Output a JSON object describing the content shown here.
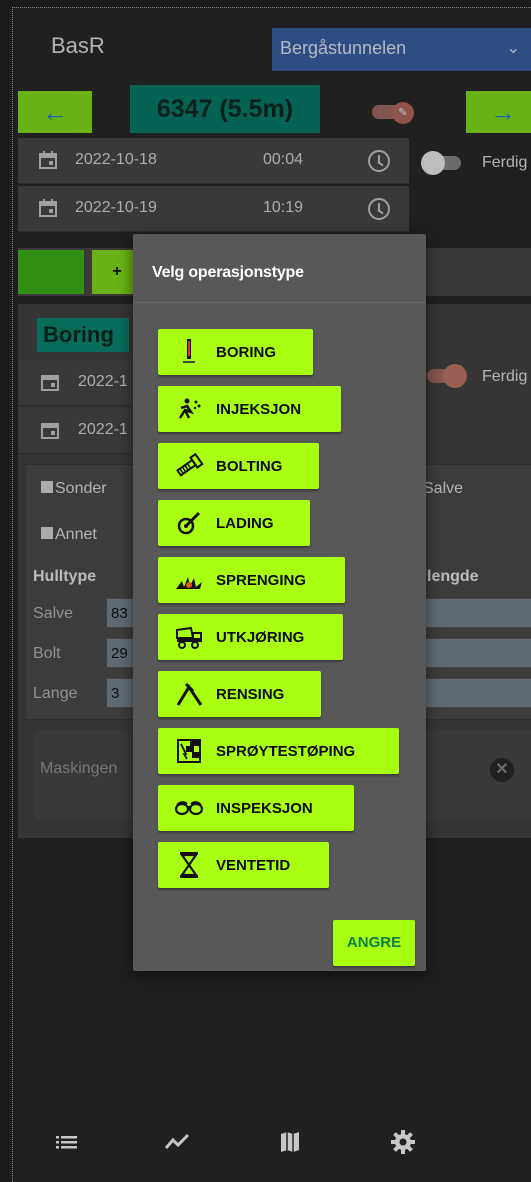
{
  "header": {
    "app_title": "BasR",
    "tunnel_selected": "Bergåstunnelen"
  },
  "counter": {
    "value": "6347 (5.5m)"
  },
  "log_rows": [
    {
      "date": "2022-10-18",
      "time": "00:04"
    },
    {
      "date": "2022-10-19",
      "time": "10:19"
    }
  ],
  "ferdig_label": "Ferdig",
  "op_row": {
    "add_label": "+"
  },
  "operation": {
    "tag": "Boring",
    "sub_dates": [
      "2022-1",
      "2022-1"
    ],
    "ferdig_label": "Ferdig"
  },
  "form": {
    "sonder_label": "Sonder",
    "salve_label": "Salve",
    "annet_label": "Annet",
    "hulltype_label": "Hulltype",
    "lengde_label": "lengde",
    "rows": [
      {
        "label": "Salve",
        "value": "83"
      },
      {
        "label": "Bolt",
        "value": "29"
      },
      {
        "label": "Lange",
        "value": "3"
      }
    ]
  },
  "masking": {
    "label": "Maskingen"
  },
  "dialog": {
    "title": "Velg operasjonstype",
    "options": [
      {
        "label": "BORING",
        "icon": "drill-icon"
      },
      {
        "label": "INJEKSJON",
        "icon": "injection-icon"
      },
      {
        "label": "BOLTING",
        "icon": "bolt-icon"
      },
      {
        "label": "LADING",
        "icon": "charging-icon"
      },
      {
        "label": "SPRENGING",
        "icon": "explosion-icon"
      },
      {
        "label": "UTKJØRING",
        "icon": "truck-icon"
      },
      {
        "label": "RENSING",
        "icon": "pickaxe-icon"
      },
      {
        "label": "SPRØYTESTØPING",
        "icon": "shotcrete-icon"
      },
      {
        "label": "INSPEKSJON",
        "icon": "glasses-icon"
      },
      {
        "label": "VENTETID",
        "icon": "hourglass-icon"
      }
    ],
    "cancel_label": "ANGRE"
  },
  "colors": {
    "accent_green": "#a8ff12",
    "counter_teal": "#087e6a",
    "select_blue": "#3b63a8"
  }
}
